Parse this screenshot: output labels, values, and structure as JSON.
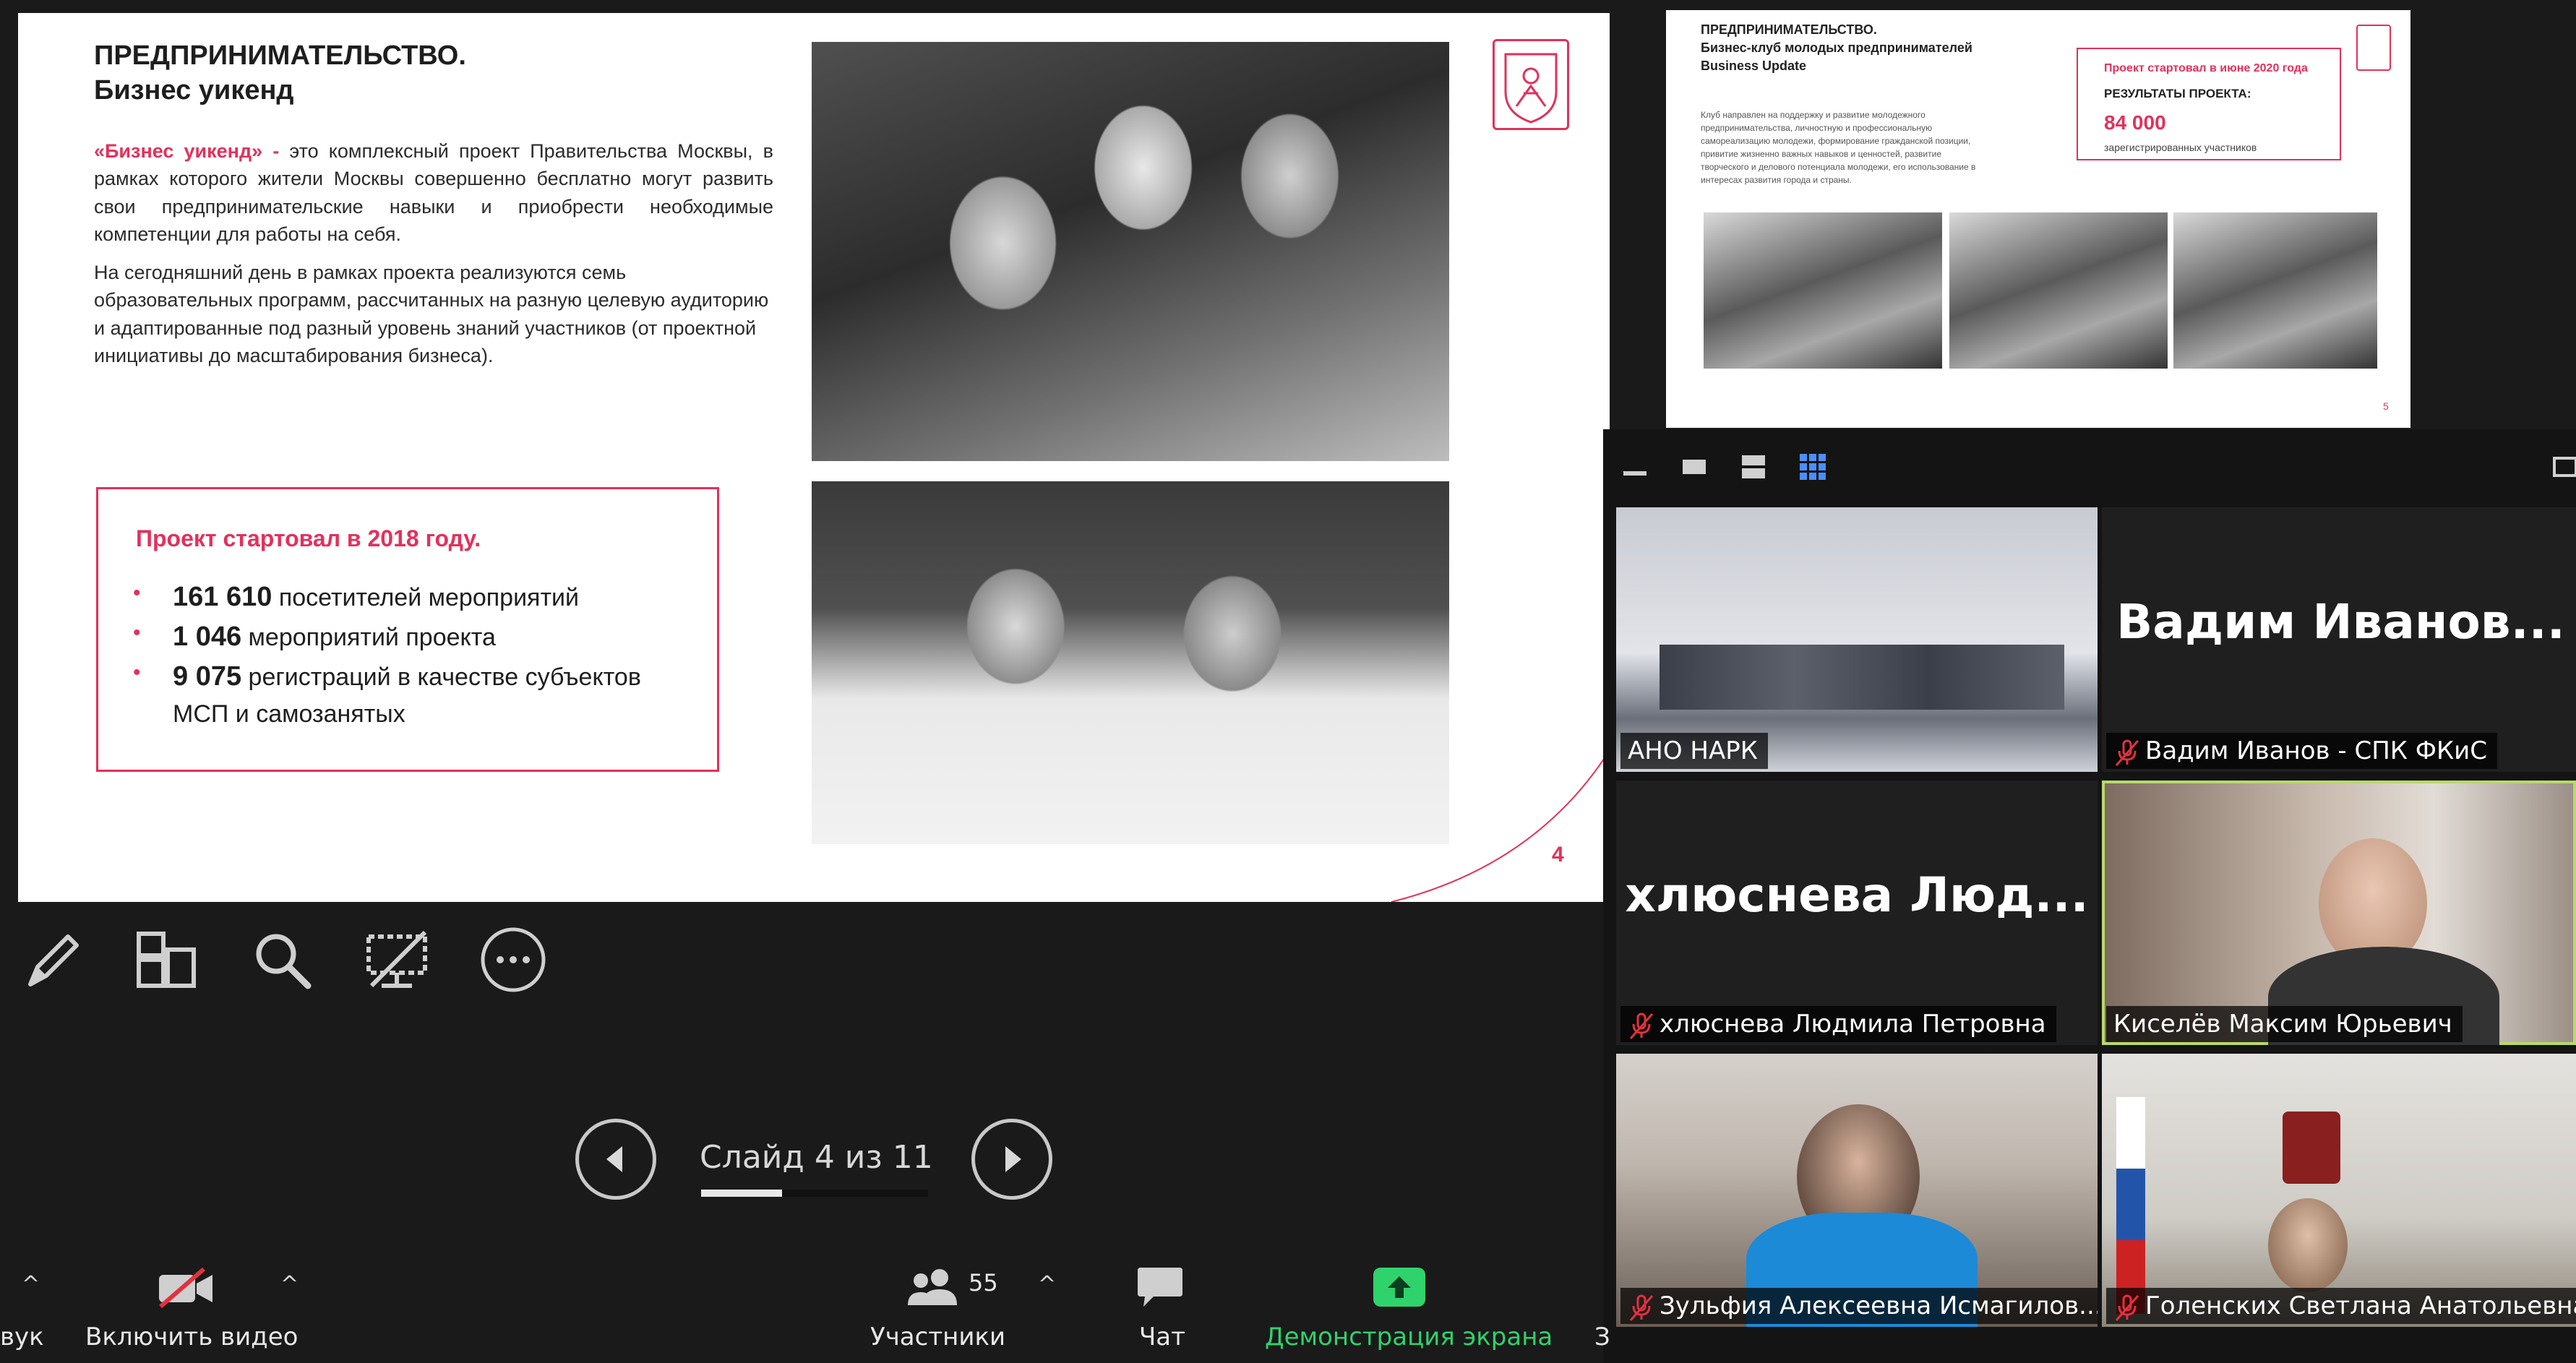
{
  "slide": {
    "title_line1": "ПРЕДПРИНИМАТЕЛЬСТВО.",
    "title_line2": "Бизнес уикенд",
    "para1_highlight": "«Бизнес уикенд» -",
    "para1_text": " это комплексный проект Правительства Москвы, в рамках которого жители Москвы совершенно бесплатно могут развить свои предпринимательские навыки и приобрести необходимые компетенции для работы на себя.",
    "para2_text": "На сегодняшний день в рамках проекта реализуются семь образовательных программ, рассчитанных на разную целевую аудиторию и адаптированные под разный уровень знаний участников (от проектной инициативы до масштабирования бизнеса).",
    "results_heading": "Проект стартовал в 2018 году.",
    "results": [
      {
        "num": "161 610",
        "text": " посетителей мероприятий"
      },
      {
        "num": "1 046",
        "text": " мероприятий проекта"
      },
      {
        "num": "9 075",
        "text": " регистраций в качестве субъектов МСП и самозанятых"
      }
    ],
    "page_number": "4",
    "accent_color": "#e2315b"
  },
  "slide2": {
    "title_line1": "ПРЕДПРИНИМАТЕЛЬСТВО.",
    "title_line2": "Бизнес-клуб молодых предпринимателей",
    "title_line3": "Business Update",
    "body": "Клуб направлен на поддержку и развитие молодежного предпринимательства, личностную и профессиональную самореализацию молодежи, формирование гражданской позиции, привитие жизненно важных навыков и ценностей, развитие творческого и делового потенциала молодежи, его использование в интересах развития города и страны.",
    "box_line1": "Проект стартовал в июне 2020 года",
    "box_line2": "РЕЗУЛЬТАТЫ ПРОЕКТА:",
    "box_value": "84 000",
    "box_line3": "зарегистрированных участников",
    "page_number": "5"
  },
  "slide_nav": {
    "counter": "Слайд 4 из 11"
  },
  "participants_tiles": [
    {
      "name": "АНО НАРК",
      "muted": false
    },
    {
      "name": "Вадим Иванов - СПК ФКиС",
      "big": "Вадим  Иванов...",
      "muted": true
    },
    {
      "name": "хлюснева Людмила Петровна",
      "big": "хлюснева  Люд...",
      "muted": true
    },
    {
      "name": "Киселёв Максим Юрьевич",
      "muted": false,
      "active": true
    },
    {
      "name": "Зульфия Алексеевна Исмагилов...",
      "muted": true
    },
    {
      "name": "Голенских Светлана Анатольевна",
      "muted": true
    }
  ],
  "controls": {
    "audio_label": "вук",
    "video_label": "Включить видео",
    "participants_label": "Участники",
    "participants_count": "55",
    "chat_label": "Чат",
    "share_label": "Демонстрация экрана",
    "share_color": "#2fd36b",
    "more_label": "З"
  }
}
